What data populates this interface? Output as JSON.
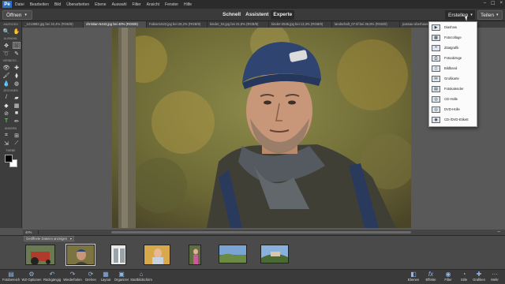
{
  "menubar": {
    "logo": "Pe",
    "items": [
      "Datei",
      "Bearbeiten",
      "Bild",
      "Überarbeiten",
      "Ebene",
      "Auswahl",
      "Filter",
      "Ansicht",
      "Fenster",
      "Hilfe"
    ],
    "controls": [
      "–",
      "☐",
      "×"
    ]
  },
  "modebar": {
    "open_label": "Öffnen",
    "modes": [
      "Schnell",
      "Assistent",
      "Experte"
    ],
    "create_label": "Erstellen",
    "share_label": "Teilen"
  },
  "tabs": [
    "_1213883.jpg bei 32,4% (RGB/8)",
    "christian-5443.jpg bei 40% (RGB/8)",
    "Fabian1523.jpg bei 25,2% (RGB/8)",
    "kinder_04.jpg bei 31,8% (RGB/8)",
    "kinder-2536.jpg bei 13,3% (RGB/8)",
    "landschaft_07.tif bei 36,8% (RGB/8)",
    "passau-oberhaus-4..."
  ],
  "toolbar": {
    "sections": [
      "ANZEIGEN",
      "AUSWAHL",
      "VERBESS...",
      "ZEICHNEN",
      "ÄNDERN",
      "FARBE"
    ]
  },
  "status": {
    "zoom": "40%",
    "right_marker": "–"
  },
  "photobin": {
    "select_label": "Geöffnete Dateien anzeigen"
  },
  "taskbar": {
    "left": [
      {
        "label": "Fotobereich",
        "icon": "photo-bin-icon"
      },
      {
        "label": "WZ-Optionen",
        "icon": "tool-options-icon"
      },
      {
        "label": "Rückgängig",
        "icon": "undo-icon"
      },
      {
        "label": "Wiederholen",
        "icon": "redo-icon"
      },
      {
        "label": "Drehen",
        "icon": "rotate-icon"
      },
      {
        "label": "Layout",
        "icon": "layout-icon"
      },
      {
        "label": "Organizer",
        "icon": "organizer-icon"
      },
      {
        "label": "Startbildschirm",
        "icon": "home-icon"
      }
    ],
    "right": [
      {
        "label": "Ebenen",
        "icon": "layers-icon"
      },
      {
        "label": "Effekte",
        "icon": "effects-icon"
      },
      {
        "label": "Filter",
        "icon": "filter-icon"
      },
      {
        "label": "Stile",
        "icon": "styles-icon"
      },
      {
        "label": "Grafiken",
        "icon": "graphics-icon"
      },
      {
        "label": "Mehr",
        "icon": "more-icon"
      }
    ]
  },
  "create_menu": {
    "items": [
      "Diashow",
      "Fotocollage",
      "Zitatgrafik",
      "Fotoabzüge",
      "Bildband",
      "Grußkarte",
      "Fotokalender",
      "CD-Hülle",
      "DVD-Hülle",
      "CD-/DVD-Etikett"
    ]
  }
}
